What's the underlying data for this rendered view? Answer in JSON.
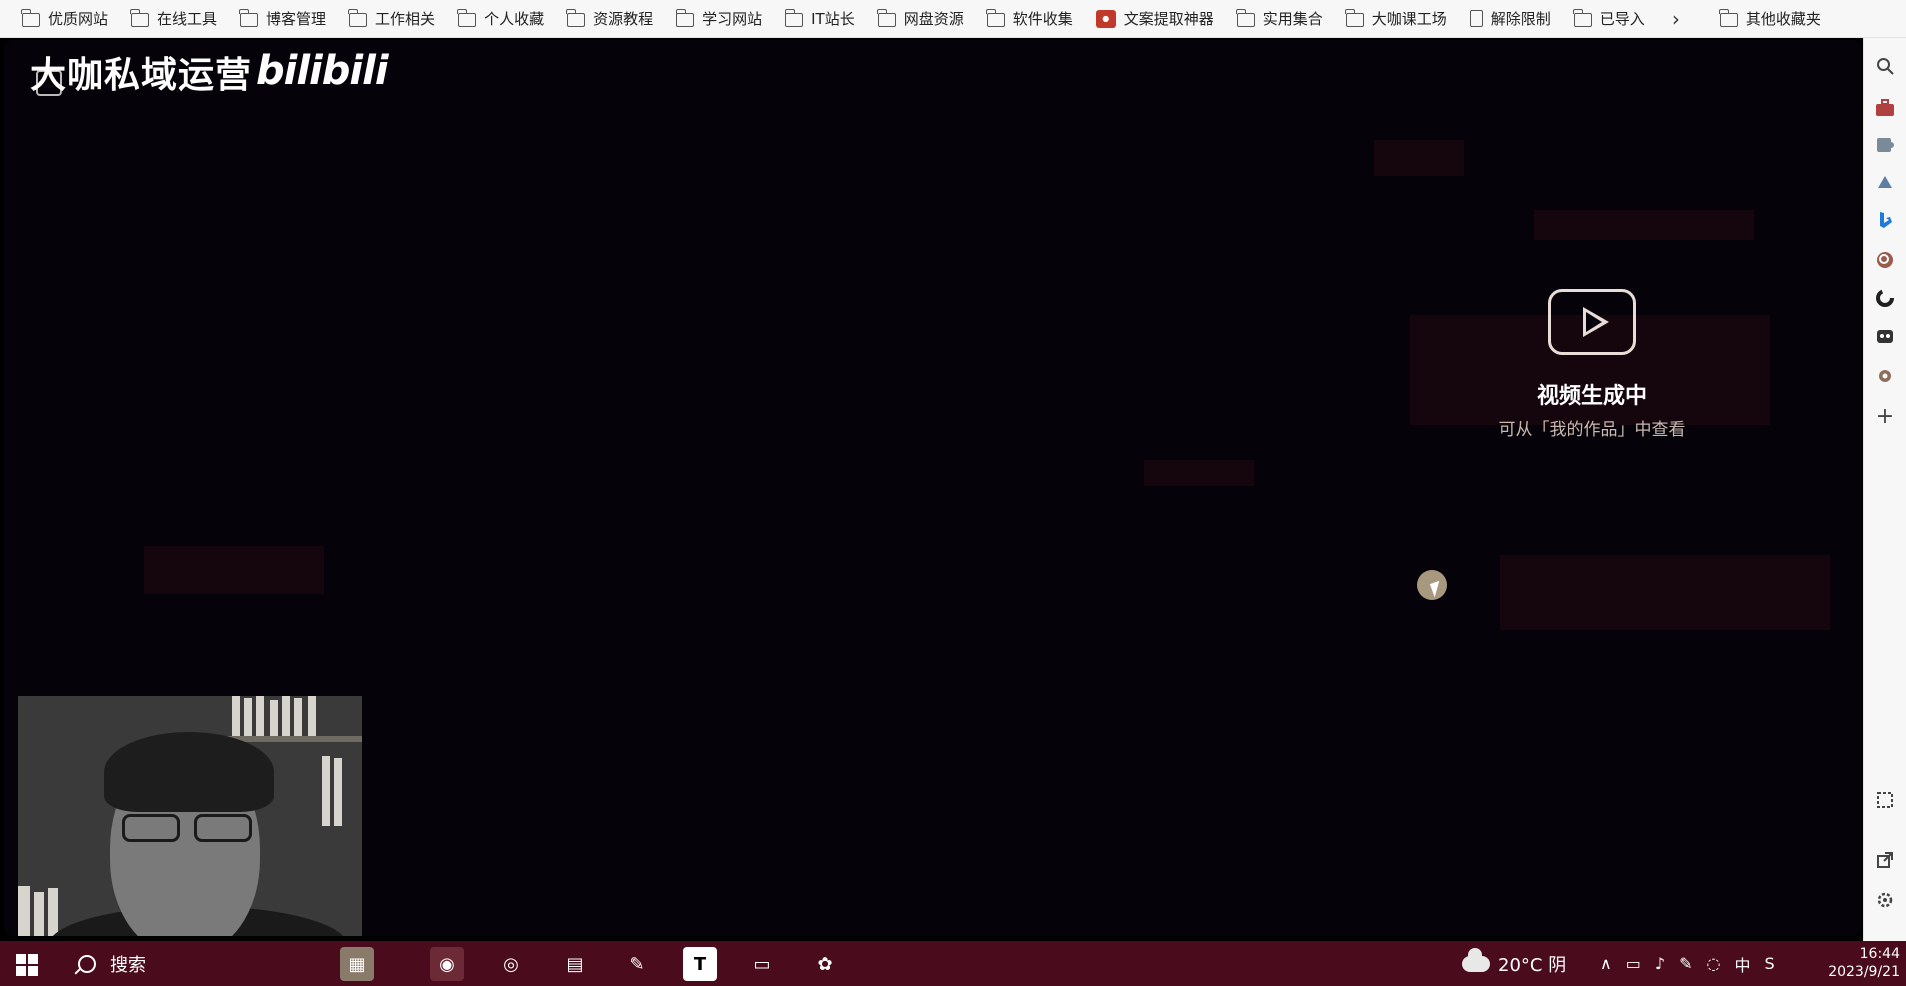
{
  "bookmarks": [
    {
      "label": "优质网站",
      "icon": "folder-icon"
    },
    {
      "label": "在线工具",
      "icon": "folder-icon"
    },
    {
      "label": "博客管理",
      "icon": "folder-icon"
    },
    {
      "label": "工作相关",
      "icon": "folder-icon"
    },
    {
      "label": "个人收藏",
      "icon": "folder-icon"
    },
    {
      "label": "资源教程",
      "icon": "folder-icon"
    },
    {
      "label": "学习网站",
      "icon": "folder-icon"
    },
    {
      "label": "IT站长",
      "icon": "folder-icon"
    },
    {
      "label": "网盘资源",
      "icon": "folder-icon"
    },
    {
      "label": "软件收集",
      "icon": "folder-icon"
    },
    {
      "label": "文案提取神器",
      "icon": "app-icon"
    },
    {
      "label": "实用集合",
      "icon": "folder-icon"
    },
    {
      "label": "大咖课工场",
      "icon": "folder-icon"
    },
    {
      "label": "解除限制",
      "icon": "doc-icon"
    },
    {
      "label": "已导入",
      "icon": "folder-icon"
    }
  ],
  "bookmarks_more": "›",
  "bookmarks_other": "其他收藏夹",
  "stage": {
    "brand": "大咖私域运营",
    "bili_logo": "bilibili",
    "status_title": "视频生成中",
    "status_sub": "可从「我的作品」中查看"
  },
  "taskbar": {
    "search_label": "搜索",
    "weather": "20°C 阴",
    "ime": "中",
    "time": "16:44",
    "date": "2023/9/21"
  },
  "colors": {
    "taskbar_bg": "#4a0b1c",
    "stage_bg": "#050309",
    "bookmark_bar_bg": "#f7f7f7"
  }
}
